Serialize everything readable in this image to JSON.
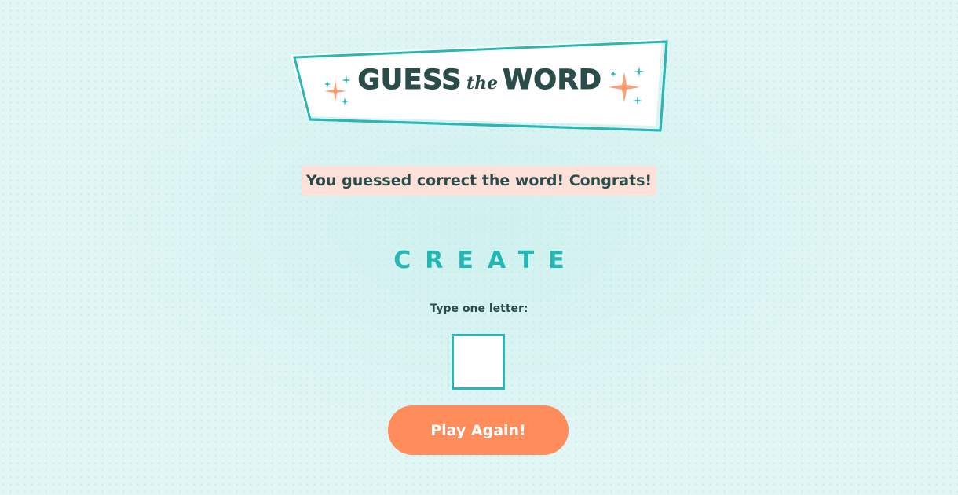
{
  "header": {
    "title_part1": "GUESS",
    "title_part2": "the",
    "title_part3": "WORD"
  },
  "message": {
    "text": "You guessed correct the word! Congrats!"
  },
  "word_in_progress": "CREATE",
  "guess_form": {
    "label": "Type one letter:",
    "input_value": "",
    "button_label": "Play Again!"
  },
  "colors": {
    "background": "#e2f6f5",
    "accent_teal": "#2ab7b4",
    "accent_orange": "#ff8d5c",
    "message_bg": "#fde0d8",
    "text_dark": "#2b4d4a"
  }
}
